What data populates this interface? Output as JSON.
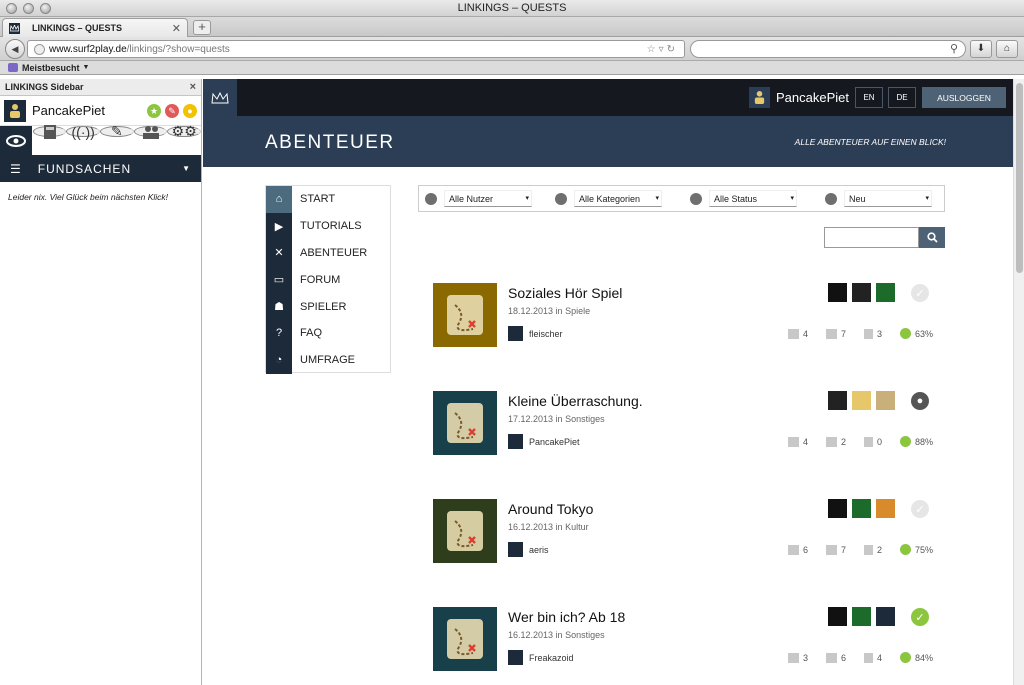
{
  "browser": {
    "window_title": "LINKINGS – QUESTS",
    "tab_title": "LINKINGS – QUESTS",
    "url_domain": "www.surf2play.de",
    "url_path": "/linkings/?show=quests",
    "bookmark_label": "Meistbesucht"
  },
  "sidebar": {
    "title": "LINKINGS Sidebar",
    "username": "PancakePiet",
    "section_label": "FUNDSACHEN",
    "message": "Leider nix. Viel Glück beim nächsten Klick!"
  },
  "header": {
    "username": "PancakePiet",
    "lang_en": "EN",
    "lang_de": "DE",
    "logout": "AUSLOGGEN",
    "page_title": "ABENTEUER",
    "subtitle": "ALLE ABENTEUER AUF EINEN BLICK!"
  },
  "nav": [
    {
      "label": "START",
      "icon": "start-icon"
    },
    {
      "label": "TUTORIALS",
      "icon": "play-icon"
    },
    {
      "label": "ABENTEUER",
      "icon": "map-icon"
    },
    {
      "label": "FORUM",
      "icon": "chat-icon"
    },
    {
      "label": "SPIELER",
      "icon": "players-icon"
    },
    {
      "label": "FAQ",
      "icon": "question-icon"
    },
    {
      "label": "UMFRAGE",
      "icon": "poll-icon"
    }
  ],
  "filters": [
    {
      "label": "Alle Nutzer",
      "icon": "user-icon"
    },
    {
      "label": "Alle Kategorien",
      "icon": "list-icon"
    },
    {
      "label": "Alle Status",
      "icon": "check-icon"
    },
    {
      "label": "Neu",
      "icon": "sort-icon"
    }
  ],
  "quests": [
    {
      "title": "Soziales Hör Spiel",
      "date": "18.12.2013",
      "in_label": "in",
      "category": "Spiele",
      "author": "fleischer",
      "stat1": "4",
      "stat2": "7",
      "stat3": "3",
      "rating": "63%",
      "status": "none",
      "color": "#8a6a00"
    },
    {
      "title": "Kleine Überraschung.",
      "date": "17.12.2013",
      "in_label": "in",
      "category": "Sonstiges",
      "author": "PancakePiet",
      "stat1": "4",
      "stat2": "2",
      "stat3": "0",
      "rating": "88%",
      "status": "owner",
      "color": "#17404a"
    },
    {
      "title": "Around Tokyo",
      "date": "16.12.2013",
      "in_label": "in",
      "category": "Kultur",
      "author": "aeris",
      "stat1": "6",
      "stat2": "7",
      "stat3": "2",
      "rating": "75%",
      "status": "none",
      "color": "#2e3d1c"
    },
    {
      "title": "Wer bin ich? Ab 18",
      "date": "16.12.2013",
      "in_label": "in",
      "category": "Sonstiges",
      "author": "Freakazoid",
      "stat1": "3",
      "stat2": "6",
      "stat3": "4",
      "rating": "84%",
      "status": "done",
      "color": "#17404a"
    }
  ],
  "colors": {
    "dark": "#1d2a3a",
    "hero": "#2c3e55",
    "accent": "#4d6274",
    "green": "#8cc63f"
  }
}
